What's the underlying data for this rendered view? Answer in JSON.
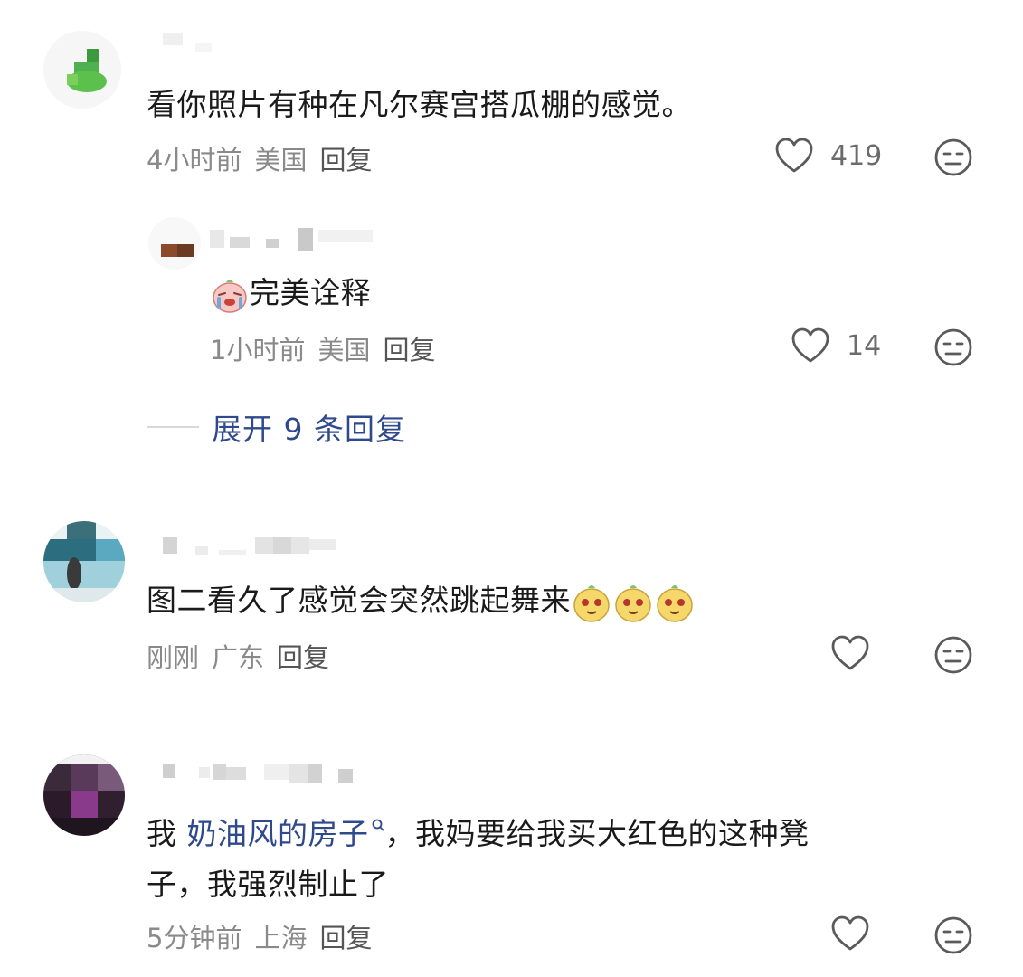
{
  "comments": [
    {
      "text": "看你照片有种在凡尔赛宫搭瓜棚的感觉。",
      "time": "4小时前",
      "location": "美国",
      "reply_label": "回复",
      "likes": "419"
    },
    {
      "text": "完美诠释",
      "time": "1小时前",
      "location": "美国",
      "reply_label": "回复",
      "likes": "14"
    },
    {
      "text": "图二看久了感觉会突然跳起舞来",
      "time": "刚刚",
      "location": "广东",
      "reply_label": "回复",
      "likes": ""
    },
    {
      "text_before_link": "我 ",
      "link_text": "奶油风的房子",
      "text_after_link": "，我妈要给我买大红色的这种凳",
      "text_line2": "子，我强烈制止了",
      "time": "5分钟前",
      "location": "上海",
      "reply_label": "回复",
      "likes": ""
    }
  ],
  "expand_replies_label": "展开 9 条回复",
  "icons": {
    "like": "heart-outline-icon",
    "dislike": "neutral-face-icon",
    "search_suggest": "search-icon",
    "emoji_crying": "crying-face-emoji",
    "emoji_dancing": "dancing-blob-emoji"
  },
  "colors": {
    "link": "#2f4a8c",
    "meta": "#8a8a8a",
    "text": "#1a1a1a"
  }
}
